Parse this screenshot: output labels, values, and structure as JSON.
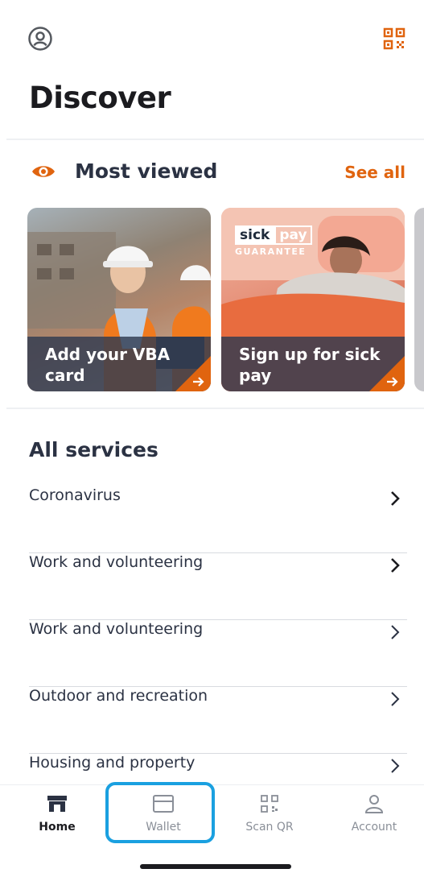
{
  "page": {
    "title": "Discover"
  },
  "most_viewed": {
    "title": "Most viewed",
    "see_all": "See all",
    "cards": [
      {
        "label": "Add your VBA card"
      },
      {
        "label": "Sign up for sick pay",
        "badge_a": "sick",
        "badge_b": "pay",
        "badge_sub": "GUARANTEE"
      }
    ]
  },
  "services": {
    "title": "All services",
    "items": [
      {
        "label": "Coronavirus"
      },
      {
        "label": "Work and volunteering"
      },
      {
        "label": "Work and volunteering"
      },
      {
        "label": "Outdoor and recreation"
      },
      {
        "label": "Housing and property"
      }
    ]
  },
  "tabbar": {
    "tabs": [
      {
        "label": "Home",
        "icon": "store-icon",
        "active": true
      },
      {
        "label": "Wallet",
        "icon": "wallet-icon"
      },
      {
        "label": "Scan QR",
        "icon": "qr-scan-icon"
      },
      {
        "label": "Account",
        "icon": "person-icon"
      }
    ],
    "highlighted": "Wallet"
  },
  "colors": {
    "accent": "#e0640f",
    "highlight": "#1aa0e0",
    "text": "#2b3243"
  }
}
